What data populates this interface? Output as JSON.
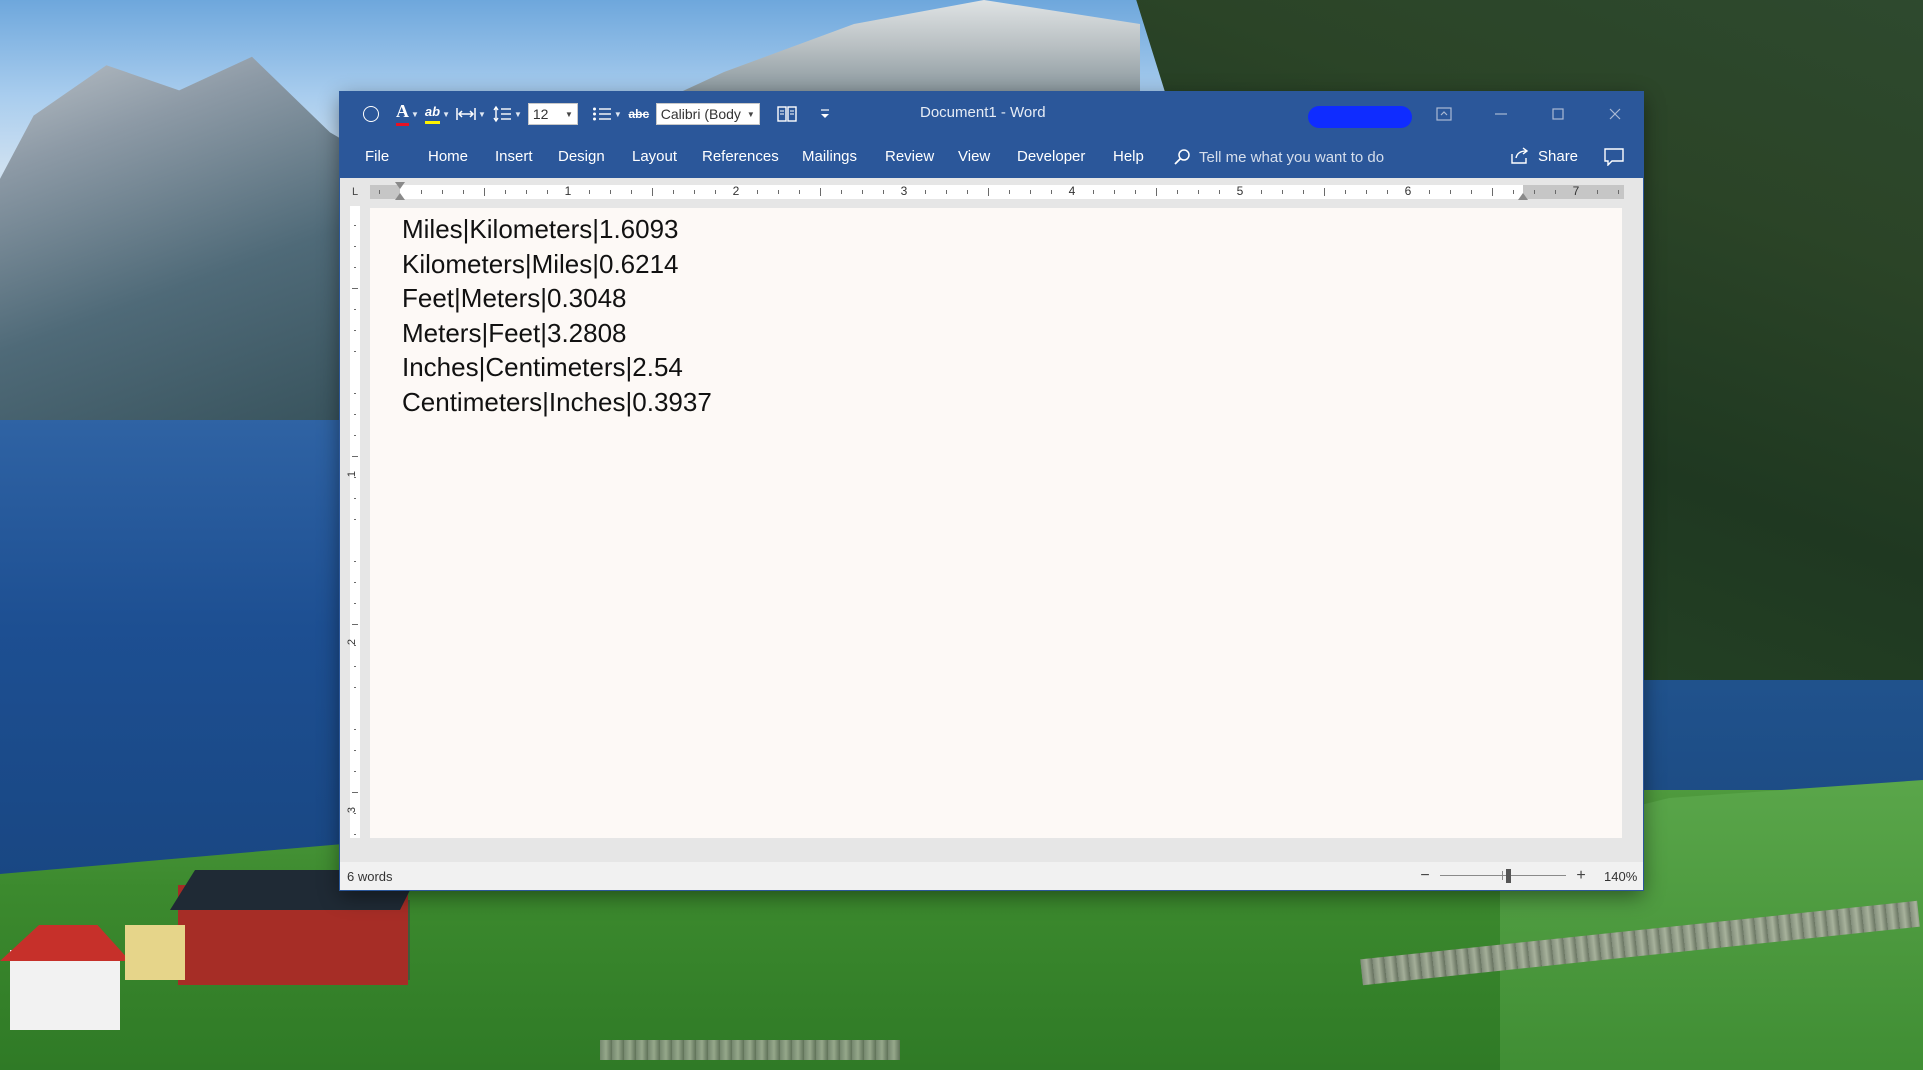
{
  "window": {
    "title": "Document1  -  Word"
  },
  "toolbar": {
    "font_size": "12",
    "font_name": "Calibri (Body",
    "strikethrough_label": "abc",
    "highlight_label": "ab",
    "font_color_label": "A",
    "accent_font_color": "#e81123",
    "accent_highlight_color": "#fff200"
  },
  "ribbon": {
    "tabs": [
      "File",
      "Home",
      "Insert",
      "Design",
      "Layout",
      "References",
      "Mailings",
      "Review",
      "View",
      "Developer",
      "Help"
    ],
    "tell_me_placeholder": "Tell me what you want to do",
    "share_label": "Share",
    "brand_color": "#2b579a"
  },
  "ruler": {
    "horizontal_numbers": [
      "1",
      "2",
      "3",
      "4",
      "5",
      "6",
      "7"
    ],
    "vertical_numbers": [
      "1",
      "2",
      "3"
    ],
    "tab_selector": "L"
  },
  "document": {
    "lines": [
      "Miles|Kilometers|1.6093",
      "Kilometers|Miles|0.6214",
      "Feet|Meters|0.3048",
      "Meters|Feet|3.2808",
      "Inches|Centimeters|2.54",
      "Centimeters|Inches|0.3937"
    ]
  },
  "status": {
    "word_count": "6 words",
    "zoom_percent": "140%",
    "zoom_minus": "−",
    "zoom_plus": "+"
  }
}
